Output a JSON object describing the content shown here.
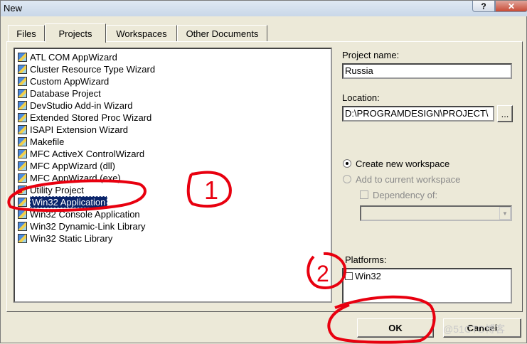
{
  "window": {
    "title": "New"
  },
  "tabs": [
    "Files",
    "Projects",
    "Workspaces",
    "Other Documents"
  ],
  "project_types": [
    "ATL COM AppWizard",
    "Cluster Resource Type Wizard",
    "Custom AppWizard",
    "Database Project",
    "DevStudio Add-in Wizard",
    "Extended Stored Proc Wizard",
    "ISAPI Extension Wizard",
    "Makefile",
    "MFC ActiveX ControlWizard",
    "MFC AppWizard (dll)",
    "MFC AppWizard (exe)",
    "Utility Project",
    "Win32 Application",
    "Win32 Console Application",
    "Win32 Dynamic-Link Library",
    "Win32 Static Library"
  ],
  "selected_project": "Win32 Application",
  "form": {
    "project_name_label": "Project name:",
    "project_name_value": "Russia",
    "location_label": "Location:",
    "location_value": "D:\\PROGRAMDESIGN\\PROJECT\\",
    "browse_label": "...",
    "create_new_label": "Create new workspace",
    "add_current_label": "Add to current workspace",
    "dependency_label": "Dependency of:",
    "platforms_label": "Platforms:",
    "platform_item": "Win32"
  },
  "buttons": {
    "ok": "OK",
    "cancel": "Cancel"
  },
  "annotations": {
    "mark1": "1",
    "mark2": "2"
  },
  "watermark": "@51CTO博客",
  "colors": {
    "annotation": "#e8000f",
    "selection": "#0a246a"
  }
}
